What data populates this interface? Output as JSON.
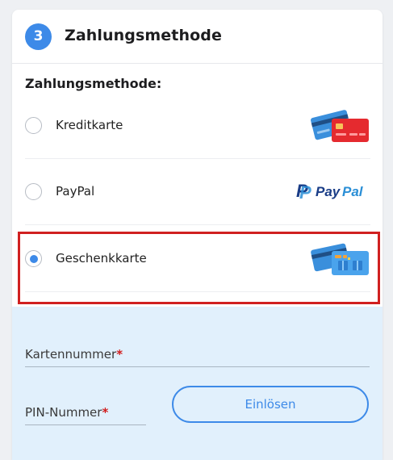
{
  "step": {
    "number": "3",
    "title": "Zahlungsmethode"
  },
  "payment": {
    "section_label": "Zahlungsmethode:",
    "options": [
      {
        "label": "Kreditkarte",
        "icon": "credit-card-icon",
        "selected": false
      },
      {
        "label": "PayPal",
        "icon": "paypal-logo",
        "logo_text": "PayPal",
        "selected": false
      },
      {
        "label": "Geschenkkarte",
        "icon": "gift-card-icon",
        "selected": true
      }
    ]
  },
  "gift_card": {
    "card_number_label": "Kartennummer",
    "pin_label": "PIN-Nummer",
    "required_mark": "*",
    "redeem_button": "Einlösen"
  },
  "colors": {
    "accent": "#3d8ae8",
    "highlight_border": "#d02020",
    "panel_background": "#e1f0fc",
    "required": "#d21c1c"
  }
}
